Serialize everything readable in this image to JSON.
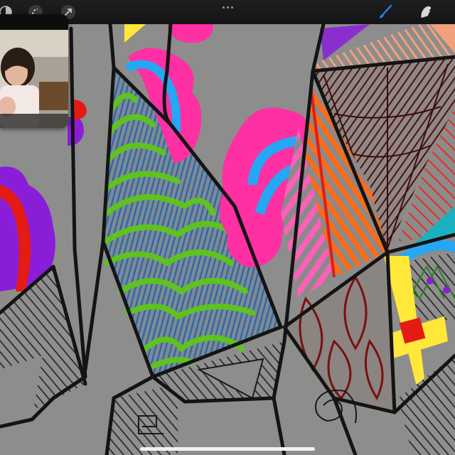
{
  "app": {
    "toolbar": {
      "left_tools": [
        "adjustments-icon",
        "selection-icon",
        "transform-arrow-icon"
      ],
      "center_menu": "more-dots-icon",
      "right_tools": [
        "brush-icon",
        "smudge-icon"
      ]
    },
    "active_tool": "brush-icon",
    "accent_color": "#2f7cf6"
  },
  "video_call": {
    "pip_visible": true
  },
  "artwork": {
    "colors": {
      "pink": "#ff2fa4",
      "blue": "#25a7f3",
      "green": "#5ec21f",
      "purple": "#8a1ed8",
      "red": "#e41b14",
      "orange": "#ff6a15",
      "yellow": "#ffe83a",
      "maroon": "#6a1216",
      "teal": "#1bb0c0",
      "black": "#1a1a1a"
    }
  }
}
